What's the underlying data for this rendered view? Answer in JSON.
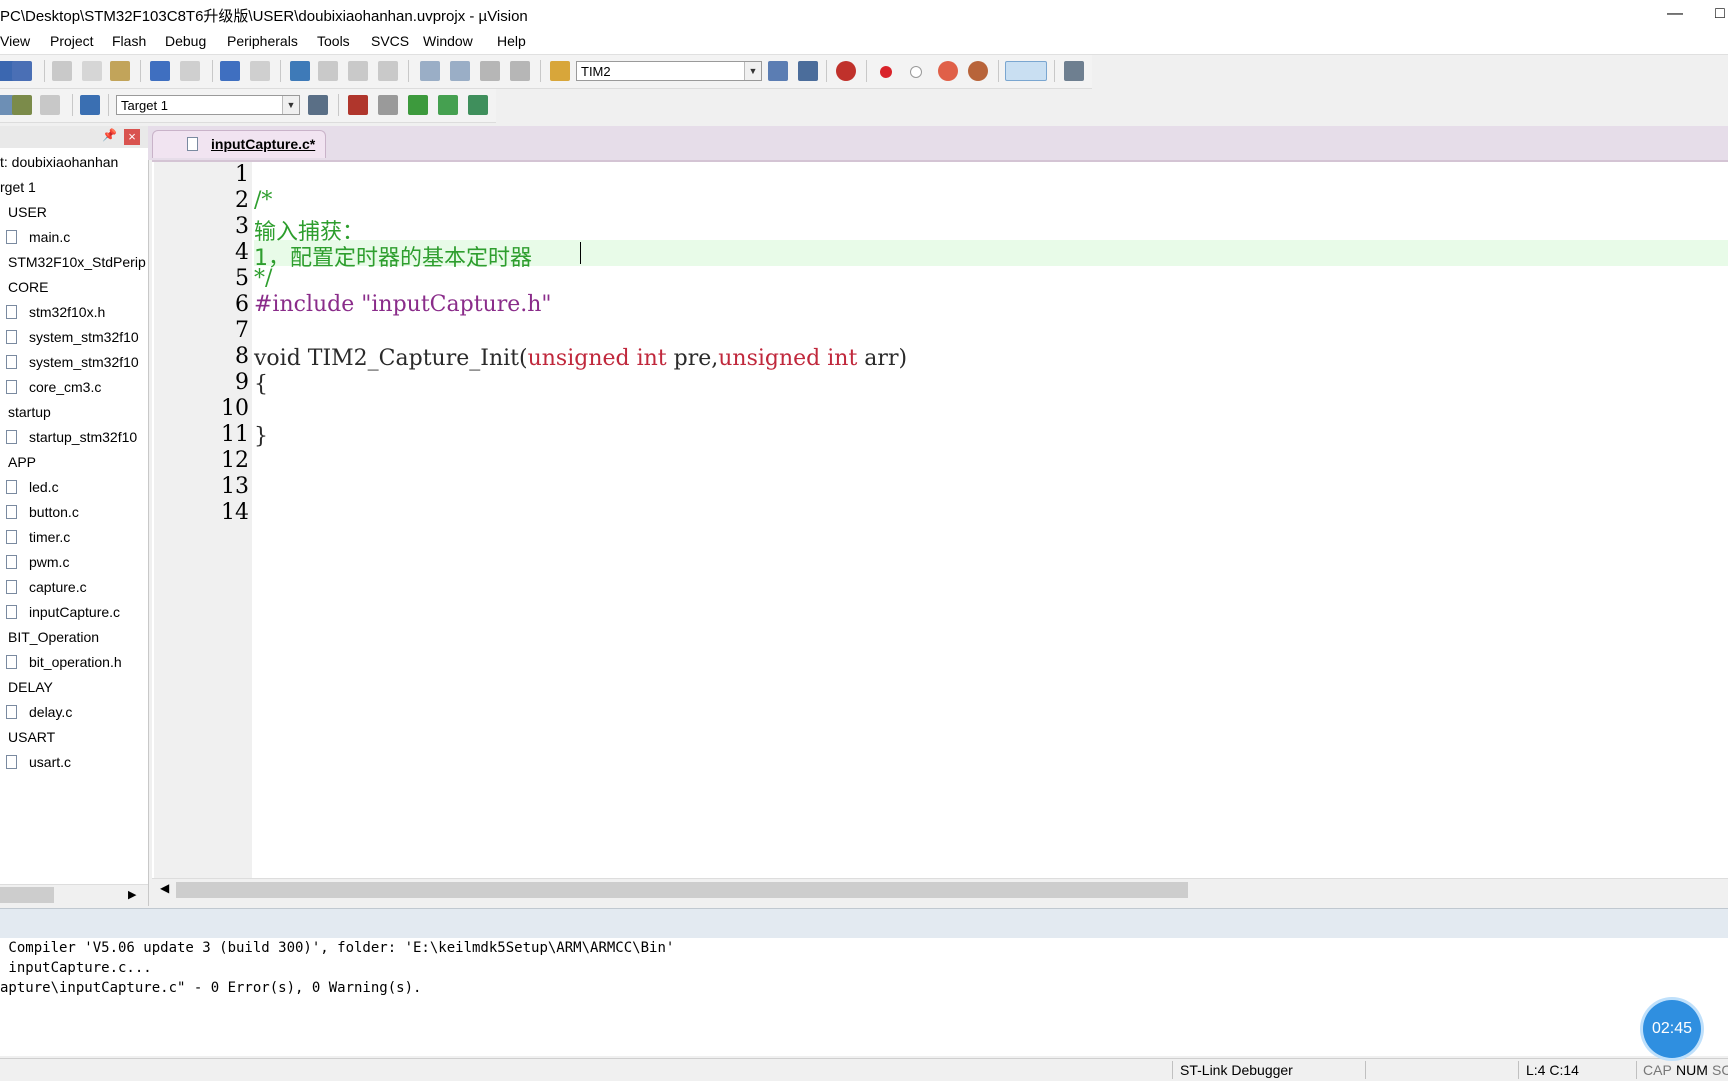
{
  "window": {
    "title": "PC\\Desktop\\STM32F103C8T6升级版\\USER\\doubixiaohanhan.uvprojx - µVision",
    "minimize_glyph": "—",
    "restore_glyph": "□"
  },
  "menu": [
    "View",
    "Project",
    "Flash",
    "Debug",
    "Peripherals",
    "Tools",
    "SVCS",
    "Window",
    "Help"
  ],
  "toolbar1": {
    "find_combo": "TIM2"
  },
  "toolbar2": {
    "target_combo": "Target 1"
  },
  "project_panel": {
    "pin_glyph": "📌",
    "close_glyph": "×",
    "items": [
      {
        "text": "t: doubixiaohanhan",
        "type": "root"
      },
      {
        "text": "rget 1",
        "type": "target"
      },
      {
        "text": "USER",
        "type": "group"
      },
      {
        "text": "main.c",
        "type": "file"
      },
      {
        "text": "STM32F10x_StdPerip",
        "type": "group"
      },
      {
        "text": "CORE",
        "type": "group"
      },
      {
        "text": "stm32f10x.h",
        "type": "file"
      },
      {
        "text": "system_stm32f10",
        "type": "file"
      },
      {
        "text": "system_stm32f10",
        "type": "file"
      },
      {
        "text": "core_cm3.c",
        "type": "file"
      },
      {
        "text": "startup",
        "type": "group"
      },
      {
        "text": "startup_stm32f10",
        "type": "file"
      },
      {
        "text": "APP",
        "type": "group"
      },
      {
        "text": "led.c",
        "type": "file"
      },
      {
        "text": "button.c",
        "type": "file"
      },
      {
        "text": "timer.c",
        "type": "file"
      },
      {
        "text": "pwm.c",
        "type": "file"
      },
      {
        "text": "capture.c",
        "type": "file"
      },
      {
        "text": "inputCapture.c",
        "type": "file"
      },
      {
        "text": "BIT_Operation",
        "type": "group"
      },
      {
        "text": "bit_operation.h",
        "type": "file"
      },
      {
        "text": "DELAY",
        "type": "group"
      },
      {
        "text": "delay.c",
        "type": "file"
      },
      {
        "text": "USART",
        "type": "group"
      },
      {
        "text": "usart.c",
        "type": "file"
      }
    ]
  },
  "editor": {
    "tab_label": "inputCapture.c*",
    "line_numbers": [
      "1",
      "2",
      "3",
      "4",
      "5",
      "6",
      "7",
      "8",
      "9",
      "10",
      "11",
      "12",
      "13",
      "14"
    ],
    "code": {
      "l2": "/*",
      "l3": "输入捕获：",
      "l4": "1，配置定时器的基本定时器",
      "l5": "*/",
      "l6_pre": "#include ",
      "l6_str": "\"inputCapture.h\"",
      "l8_a": "void TIM2_Capture_Init(",
      "l8_kw1": "unsigned int",
      "l8_b": " pre,",
      "l8_kw2": "unsigned int",
      "l8_c": " arr)",
      "l9": "{",
      "l11": "}"
    }
  },
  "build_output": [
    " Compiler 'V5.06 update 3 (build 300)', folder: 'E:\\keilmdk5Setup\\ARM\\ARMCC\\Bin'",
    " inputCapture.c...",
    "apture\\inputCapture.c\" - 0 Error(s), 0 Warning(s)."
  ],
  "status_bar": {
    "debugger": "ST-Link Debugger",
    "cursor": "L:4 C:14",
    "cap": "CAP",
    "num": "NUM",
    "scrl": "SC"
  },
  "overlay": {
    "timer": "02:45"
  }
}
